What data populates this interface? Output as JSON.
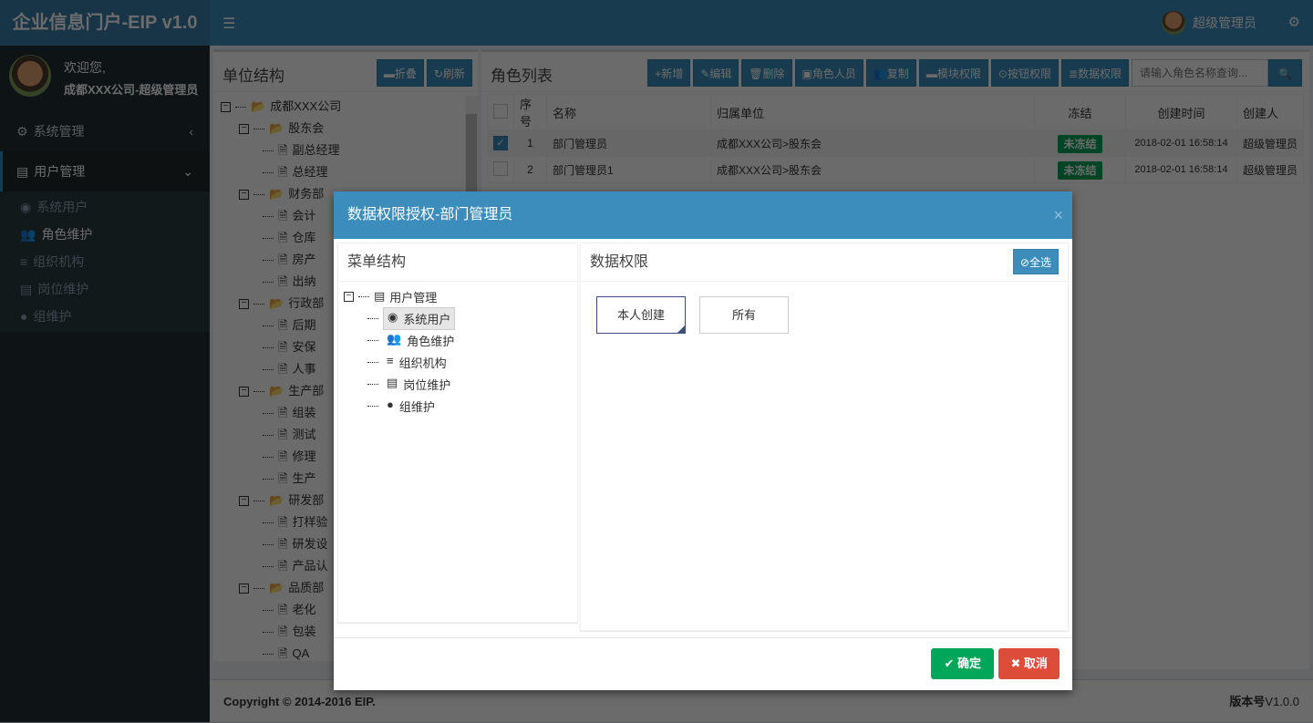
{
  "header": {
    "title": "企业信息门户-EIP v1.0",
    "user": "超级管理员"
  },
  "sidebar": {
    "welcome": "欢迎您,",
    "user_full": "成都XXX公司-超级管理员",
    "menus": [
      {
        "label": "系统管理"
      },
      {
        "label": "用户管理"
      }
    ],
    "sub": [
      {
        "label": "系统用户",
        "icon": "user-circle-icon"
      },
      {
        "label": "角色维护",
        "icon": "users-icon"
      },
      {
        "label": "组织机构",
        "icon": "bars-icon"
      },
      {
        "label": "岗位维护",
        "icon": "id-card-icon"
      },
      {
        "label": "组维护",
        "icon": "user-icon"
      }
    ]
  },
  "unit_panel": {
    "title": "单位结构",
    "collapse": "折叠",
    "refresh": "刷新",
    "root": "成都XXX公司",
    "groups": [
      {
        "name": "股东会",
        "items": [
          "副总经理",
          "总经理"
        ]
      },
      {
        "name": "财务部",
        "items": [
          "会计",
          "仓库",
          "房产",
          "出纳"
        ]
      },
      {
        "name": "行政部",
        "items": [
          "后期",
          "安保",
          "人事"
        ]
      },
      {
        "name": "生产部",
        "items": [
          "组装",
          "测试",
          "修理",
          "生产"
        ]
      },
      {
        "name": "研发部",
        "items": [
          "打样验",
          "研发设",
          "产品认"
        ]
      },
      {
        "name": "品质部",
        "items": [
          "老化",
          "包装",
          "QA"
        ]
      }
    ]
  },
  "role_panel": {
    "title": "角色列表",
    "buttons": [
      "新增",
      "编辑",
      "删除",
      "角色人员",
      "复制",
      "模块权限",
      "按钮权限",
      "数据权限"
    ],
    "search_placeholder": "请输入角色名称查询...",
    "columns": [
      "序号",
      "名称",
      "归属单位",
      "冻结",
      "创建时间",
      "创建人"
    ],
    "rows": [
      {
        "no": "1",
        "name": "部门管理员",
        "unit": "成都XXX公司>股东会",
        "frozen": "未冻结",
        "time": "2018-02-01 16:58:14",
        "creator": "超级管理员",
        "checked": true
      },
      {
        "no": "2",
        "name": "部门管理员1",
        "unit": "成都XXX公司>股东会",
        "frozen": "未冻结",
        "time": "2018-02-01 16:58:14",
        "creator": "超级管理员",
        "checked": false
      }
    ]
  },
  "footer": {
    "copyright": "Copyright © 2014-2016 ",
    "brand": "EIP.",
    "version_label": "版本号",
    "version": "V1.0.0"
  },
  "modal": {
    "title": "数据权限授权-部门管理员",
    "menu_title": "菜单结构",
    "perm_title": "数据权限",
    "select_all": "全选",
    "root": "用户管理",
    "items": [
      "系统用户",
      "角色维护",
      "组织机构",
      "岗位维护",
      "组维护"
    ],
    "perms": [
      {
        "label": "本人创建",
        "selected": true
      },
      {
        "label": "所有",
        "selected": false
      }
    ],
    "ok": "确定",
    "cancel": "取消"
  },
  "colors": {
    "primary": "#3c8dbc",
    "success": "#00a65a",
    "danger": "#dd4b39",
    "sidebar": "#222d32"
  }
}
